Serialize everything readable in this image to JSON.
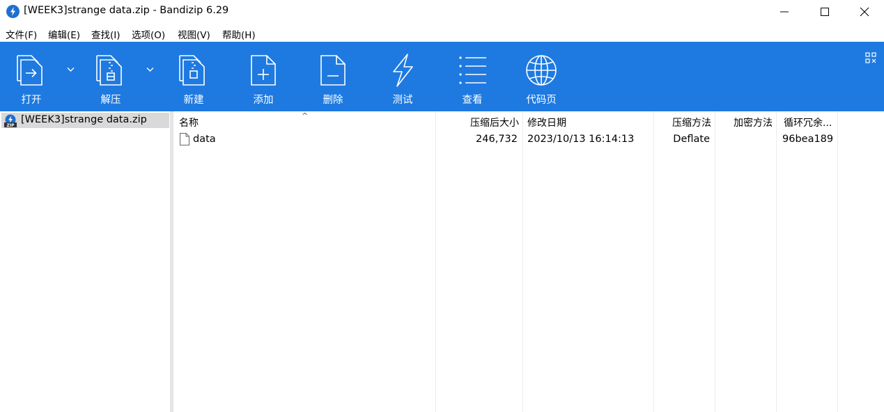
{
  "window": {
    "title": "[WEEK3]strange data.zip - Bandizip 6.29",
    "accent_color": "#1e7ae0"
  },
  "menu": [
    "文件(F)",
    "编辑(E)",
    "查找(I)",
    "选项(O)",
    "视图(V)",
    "帮助(H)"
  ],
  "toolbar": {
    "open": "打开",
    "extract": "解压",
    "new": "新建",
    "add": "添加",
    "delete": "删除",
    "test": "测试",
    "view": "查看",
    "codepage": "代码页"
  },
  "tree": {
    "root": "[WEEK3]strange data.zip"
  },
  "columns": {
    "name": "名称",
    "compressed_size": "压缩后大小",
    "modified": "修改日期",
    "method": "压缩方法",
    "encryption": "加密方法",
    "crc": "循环冗余..."
  },
  "files": [
    {
      "name": "data",
      "compressed_size": "246,732",
      "modified": "2023/10/13 16:14:13",
      "method": "Deflate",
      "encryption": "",
      "crc": "96bea189"
    }
  ]
}
